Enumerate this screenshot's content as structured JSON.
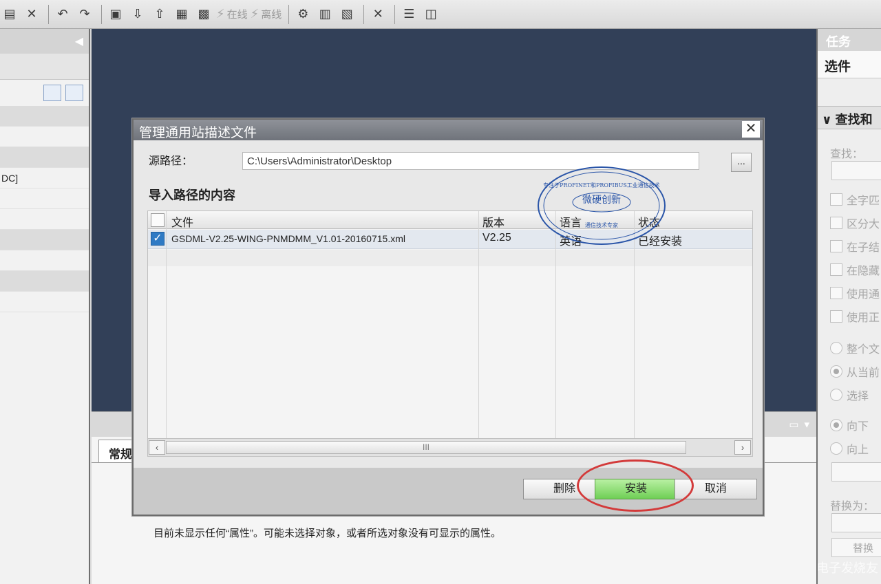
{
  "toolbar": {
    "online_label": "在线",
    "offline_label": "离线"
  },
  "left_panel": {
    "row_fragment": "DC]"
  },
  "inspector": {
    "tab_label": "常规",
    "message": "目前未显示任何“属性”。可能未选择对象，或者所选对象没有可显示的属性。"
  },
  "right_panel": {
    "title": "任务",
    "subtitle": "选件",
    "section": "查找和",
    "find_label": "查找：",
    "checkboxes": [
      "全字匹",
      "区分大",
      "在子结",
      "在隐藏",
      "使用通",
      "使用正"
    ],
    "radios_scope": [
      "整个文",
      "从当前",
      "选择"
    ],
    "radios_dir": [
      "向下",
      "向上"
    ],
    "replace_label": "替换为：",
    "replace_button": "替换"
  },
  "dialog": {
    "title": "管理通用站描述文件",
    "source_label": "源路径：",
    "source_value": "C:\\Users\\Administrator\\Desktop",
    "browse_label": "...",
    "section_title": "导入路径的内容",
    "columns": [
      "文件",
      "版本",
      "语言",
      "状态"
    ],
    "rows": [
      {
        "file": "GSDML-V2.25-WING-PNMDMM_V1.01-20160715.xml",
        "version": "V2.25",
        "language": "英语",
        "status": "已经安装",
        "checked": true
      }
    ],
    "scroll_thumb": "III",
    "delete_button": "删除",
    "install_button": "安装",
    "cancel_button": "取消"
  },
  "stamp": {
    "top_text": "专注于PROFINET和PROFIBUS工业通信技术",
    "center_text": "微硬创新",
    "bottom_text": "通信技术专家"
  },
  "watermark": "电子发烧友"
}
